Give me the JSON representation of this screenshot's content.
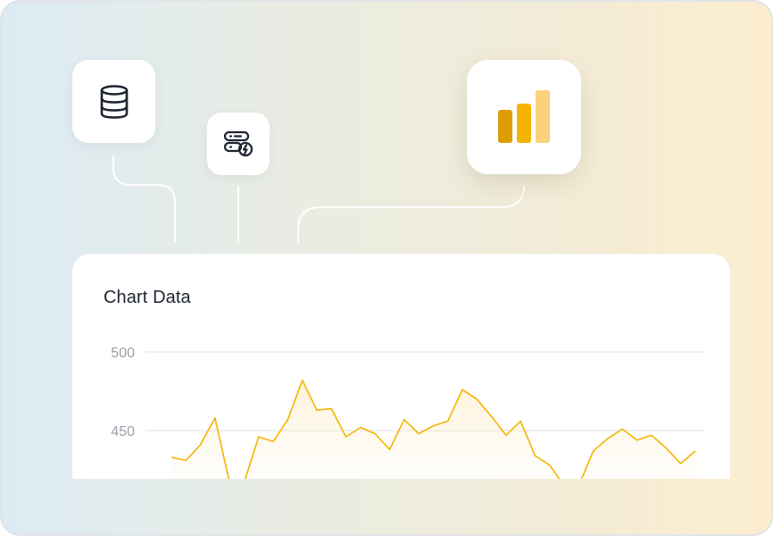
{
  "icons": {
    "database": "database-icon",
    "server": "server-bolt-icon",
    "analytics": "bar-chart-icon"
  },
  "colors": {
    "accent": "#f4b400",
    "accent_dark": "#dd9d00",
    "accent_light": "#fbd27a",
    "icon_stroke": "#1d2330"
  },
  "card": {
    "title": "Chart Data"
  },
  "chart_data": {
    "type": "area",
    "title": "Chart Data",
    "xlabel": "",
    "ylabel": "",
    "yticks": [
      500,
      450
    ],
    "ytick_labels": [
      "500",
      "450"
    ],
    "ylim": [
      420,
      505
    ],
    "grid": true,
    "legend": "none",
    "x": [
      0,
      1,
      2,
      3,
      4,
      5,
      6,
      7,
      8,
      9,
      10,
      11,
      12,
      13,
      14,
      15,
      16,
      17,
      18,
      19,
      20,
      21,
      22,
      23,
      24,
      25,
      26,
      27,
      28,
      29,
      30,
      31,
      32,
      33,
      34,
      35,
      36,
      37,
      38
    ],
    "values": [
      433,
      431,
      441,
      458,
      417,
      417,
      446,
      443,
      457,
      482,
      463,
      464,
      446,
      452,
      448,
      438,
      457,
      448,
      453,
      456,
      476,
      470,
      459,
      447,
      456,
      434,
      428,
      415,
      415,
      437,
      445,
      451,
      444,
      447,
      439,
      429,
      437,
      437,
      437
    ],
    "visible_points": 37
  }
}
